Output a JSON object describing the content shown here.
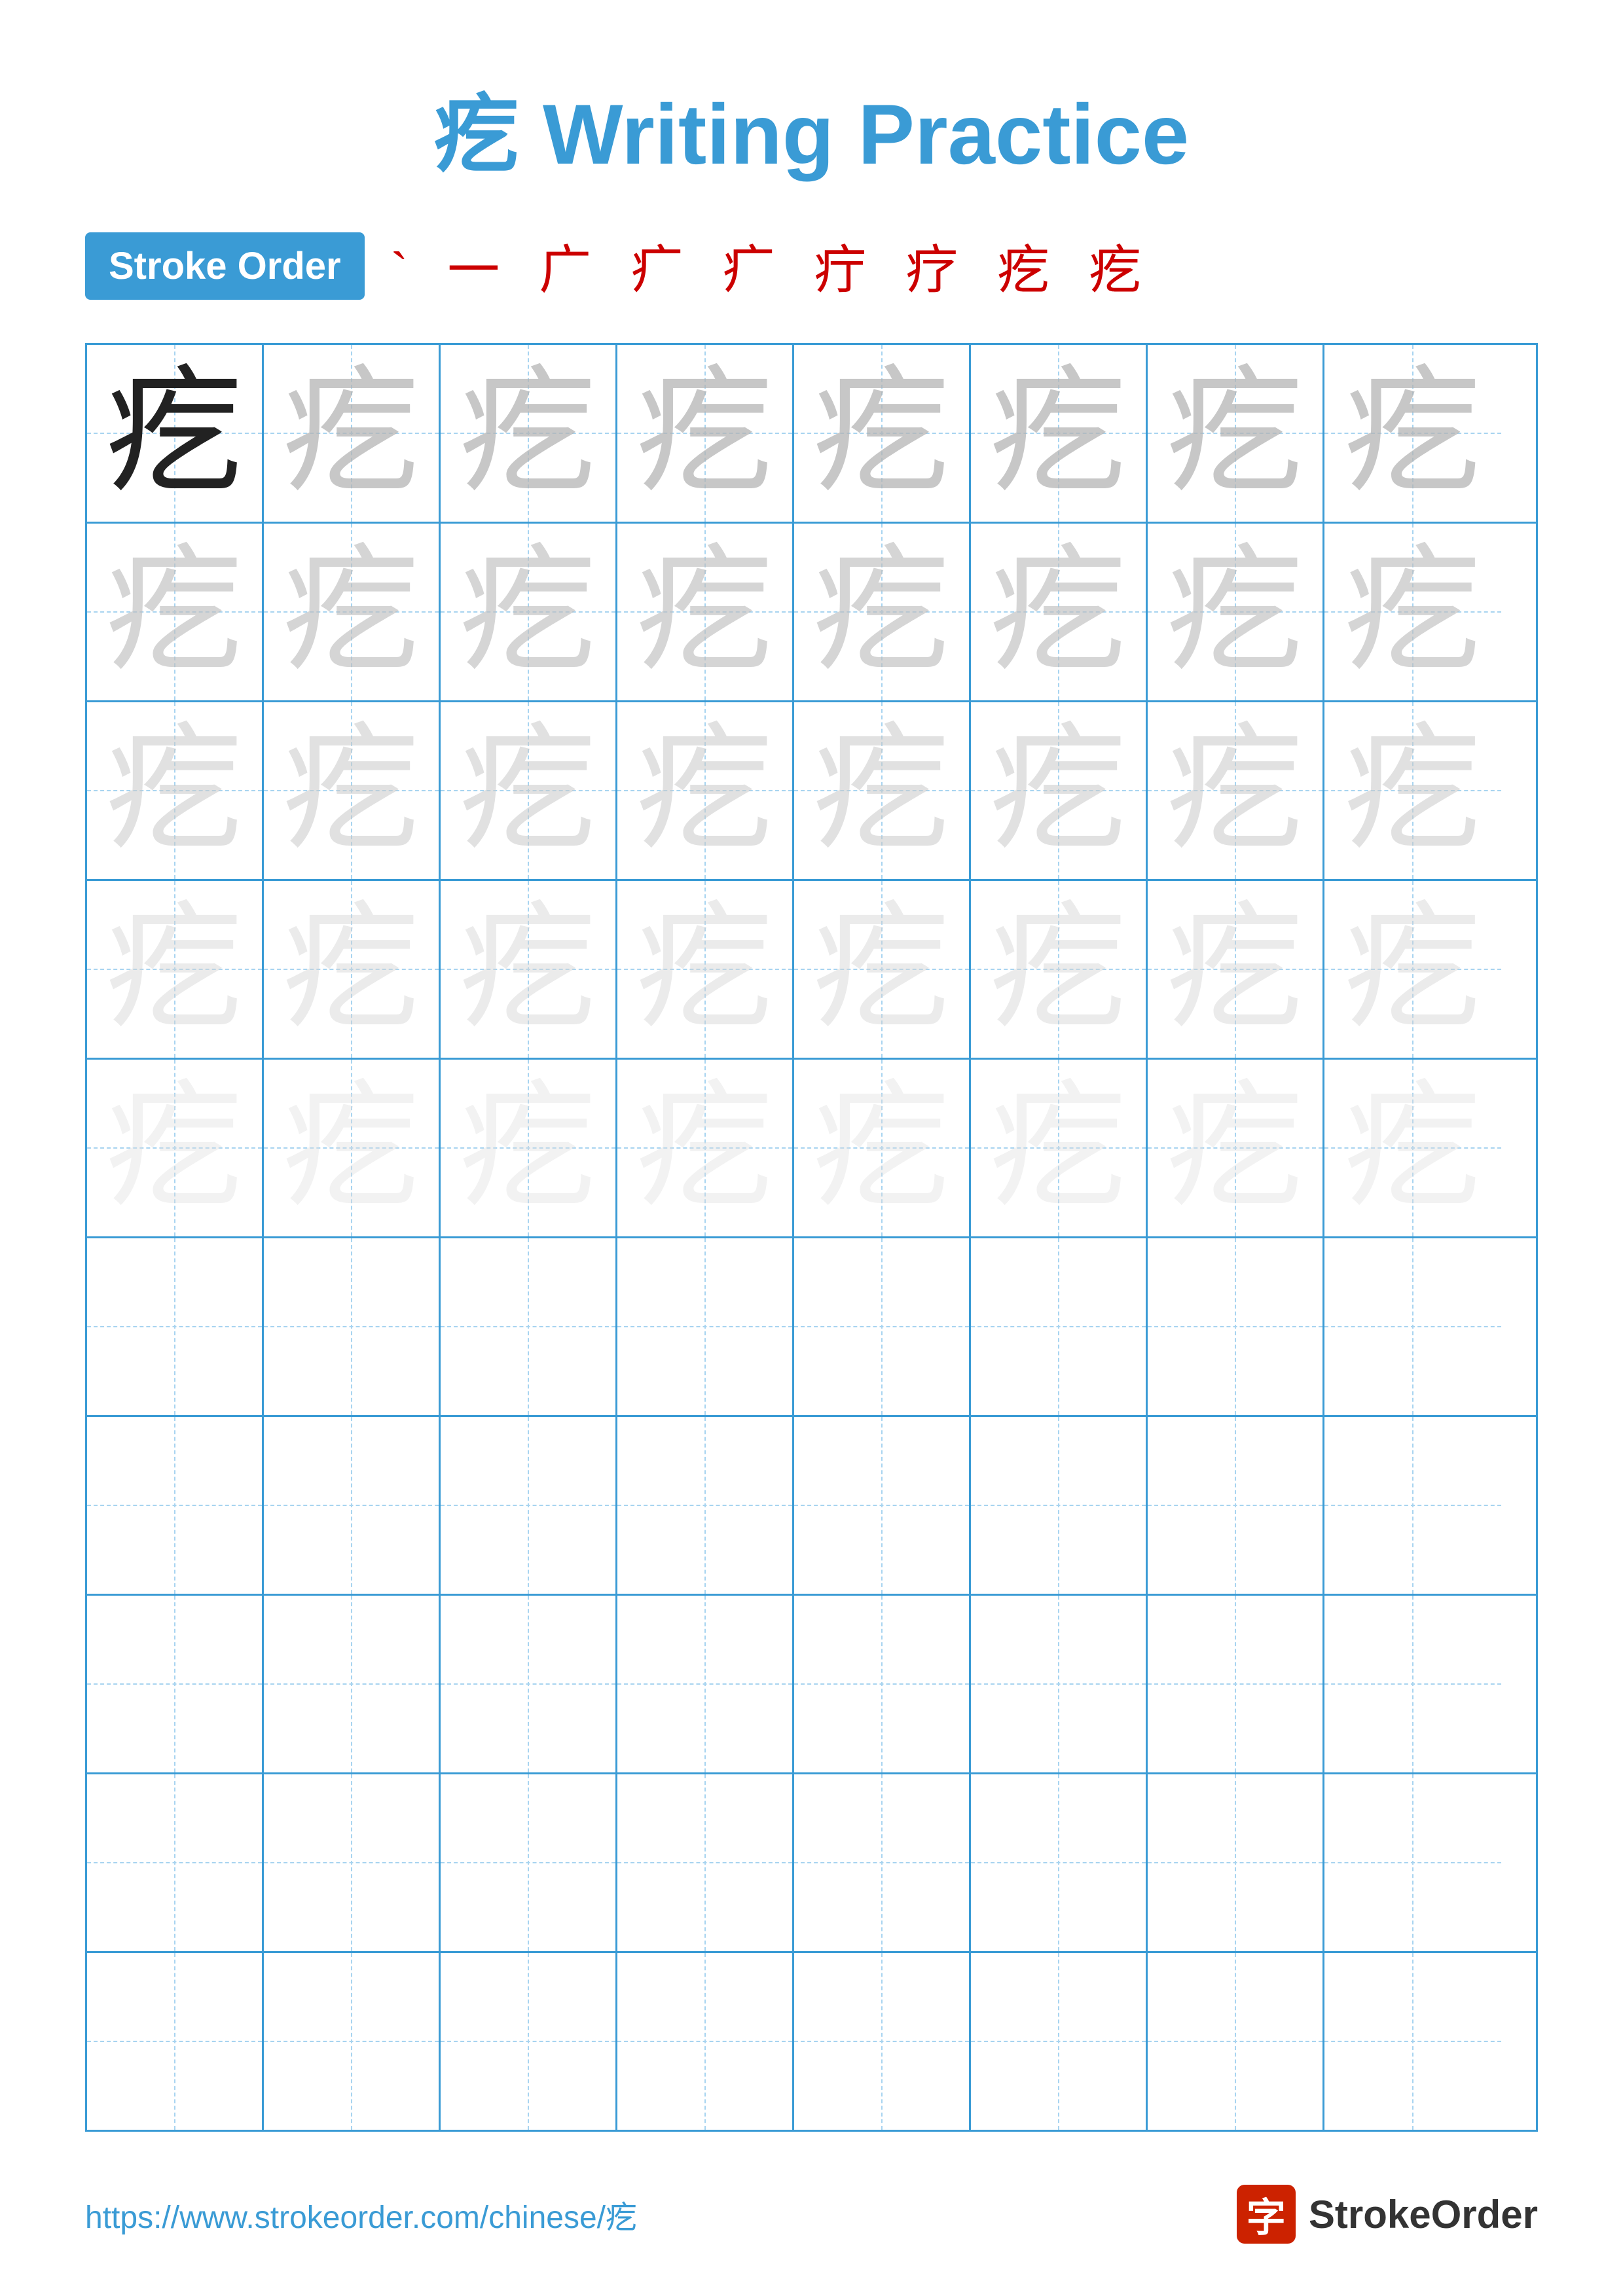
{
  "title": "疙 Writing Practice",
  "character": "疙",
  "stroke_order_label": "Stroke Order",
  "stroke_order_chars": "` 一 广 疒 疒 疔 疗 疙 疙",
  "grid": {
    "rows": 10,
    "cols": 8,
    "practice_rows_with_chars": 5,
    "practice_rows_empty": 5
  },
  "footer": {
    "url": "https://www.strokeorder.com/chinese/疙",
    "brand_char": "字",
    "brand_name": "StrokeOrder"
  },
  "colors": {
    "title_blue": "#3a9bd5",
    "stroke_red": "#cc0000",
    "grid_blue": "#3a9bd5",
    "dashed_blue": "#a8d4f0",
    "solid_char": "#222222",
    "brand_red": "#cc2200"
  }
}
